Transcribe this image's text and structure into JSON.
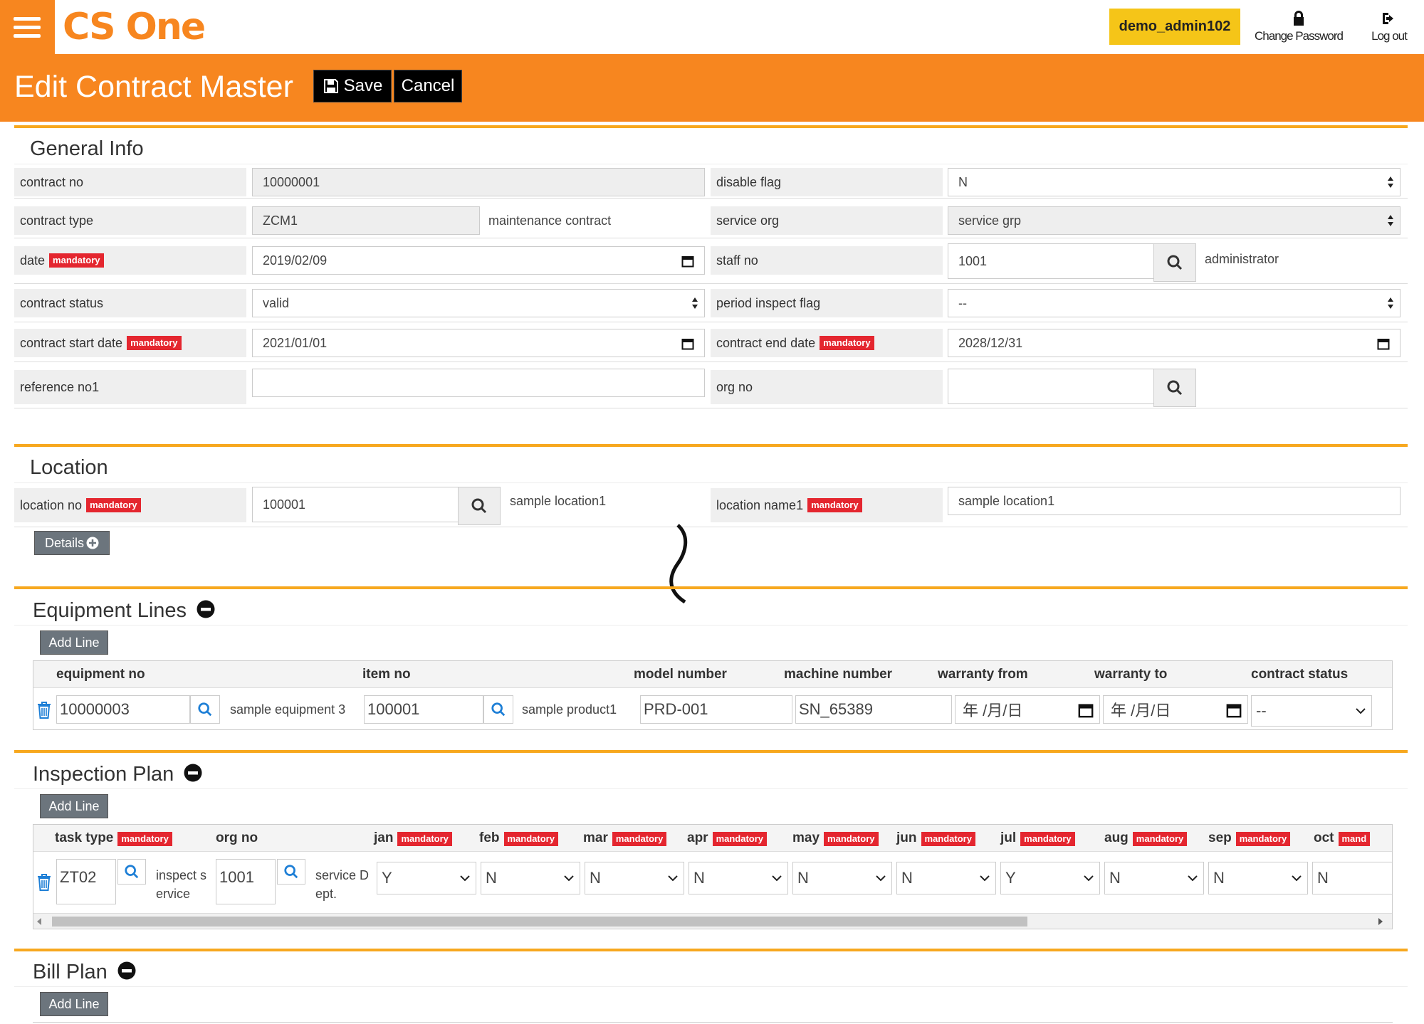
{
  "app": {
    "logo": "CS One"
  },
  "topbar": {
    "user": "demo_admin102",
    "change_password": "Change Password",
    "logout": "Log out"
  },
  "header": {
    "title": "Edit Contract Master",
    "save": "Save",
    "cancel": "Cancel"
  },
  "general": {
    "title": "General Info",
    "mandatory": "mandatory",
    "contract_no": {
      "label": "contract no",
      "value": "10000001"
    },
    "disable_flag": {
      "label": "disable flag",
      "value": "N"
    },
    "contract_type": {
      "label": "contract type",
      "value": "ZCM1",
      "desc": "maintenance contract"
    },
    "service_org": {
      "label": "service org",
      "value": "service grp"
    },
    "date": {
      "label": "date",
      "value": "2019/02/09"
    },
    "staff_no": {
      "label": "staff no",
      "value": "1001",
      "desc": "administrator"
    },
    "contract_status": {
      "label": "contract status",
      "value": "valid"
    },
    "period_inspect_flag": {
      "label": "period inspect flag",
      "value": "--"
    },
    "contract_start_date": {
      "label": "contract start date",
      "value": "2021/01/01"
    },
    "contract_end_date": {
      "label": "contract end date",
      "value": "2028/12/31"
    },
    "reference_no1": {
      "label": "reference no1",
      "value": ""
    },
    "org_no": {
      "label": "org no",
      "value": ""
    }
  },
  "location": {
    "title": "Location",
    "location_no": {
      "label": "location no",
      "value": "100001",
      "desc": "sample location1"
    },
    "location_name1": {
      "label": "location name1",
      "value": "sample location1"
    },
    "details": "Details"
  },
  "equipment": {
    "title": "Equipment Lines",
    "add_line": "Add Line",
    "headers": [
      "equipment no",
      "item no",
      "model number",
      "machine number",
      "warranty from",
      "warranty to",
      "contract status"
    ],
    "row": {
      "equipment_no": "10000003",
      "equipment_desc": "sample equipment 3",
      "item_no": "100001",
      "item_desc": "sample product1",
      "model_number": "PRD-001",
      "machine_number": "SN_65389",
      "warranty_from": "年 /月/日",
      "warranty_to": "年 /月/日",
      "contract_status": "--"
    }
  },
  "inspection": {
    "title": "Inspection Plan",
    "add_line": "Add Line",
    "headers": {
      "task_type": "task type",
      "org_no": "org no",
      "months": [
        "jan",
        "feb",
        "mar",
        "apr",
        "may",
        "jun",
        "jul",
        "aug",
        "sep",
        "oct"
      ],
      "oct_tag": "mand"
    },
    "row": {
      "task_type": "ZT02",
      "task_desc_1": "inspect s",
      "task_desc_2": "ervice",
      "org_no": "1001",
      "org_desc_1": "service D",
      "org_desc_2": "ept.",
      "months": [
        "Y",
        "N",
        "N",
        "N",
        "N",
        "N",
        "Y",
        "N",
        "N",
        "N"
      ]
    }
  },
  "bill": {
    "title": "Bill Plan",
    "add_line": "Add Line"
  }
}
